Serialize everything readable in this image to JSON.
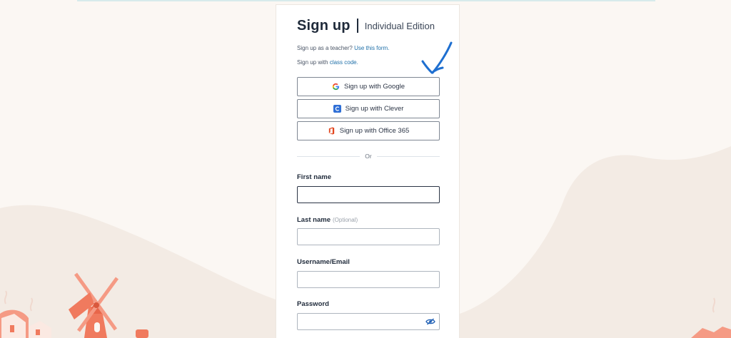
{
  "header": {
    "title": "Sign up",
    "edition": "Individual Edition"
  },
  "links": {
    "teacher_prefix": "Sign up as a teacher? ",
    "teacher_link": "Use this form.",
    "class_prefix": "Sign up with ",
    "class_link": "class code."
  },
  "sso": {
    "google": "Sign up with Google",
    "clever": "Sign up with Clever",
    "office": "Sign up with Office 365"
  },
  "divider": {
    "text": "Or"
  },
  "form": {
    "first_name_label": "First name",
    "first_name_value": "",
    "last_name_label": "Last name",
    "last_name_optional": "(Optional)",
    "last_name_value": "",
    "username_label": "Username/Email",
    "username_value": "",
    "password_label": "Password",
    "password_value": ""
  },
  "icons": {
    "google": "google-logo-icon",
    "clever": "clever-logo-icon",
    "office": "office365-logo-icon",
    "password_toggle": "eye-slash-icon",
    "annotation": "hand-drawn-check-arrow"
  },
  "colors": {
    "background": "#fbf7f3",
    "link": "#1f6fa8",
    "clever_blue": "#2f6fd6",
    "office_red": "#e2461f",
    "annotation_blue": "#1e6fd0",
    "decor_coral": "#f07a5e"
  }
}
